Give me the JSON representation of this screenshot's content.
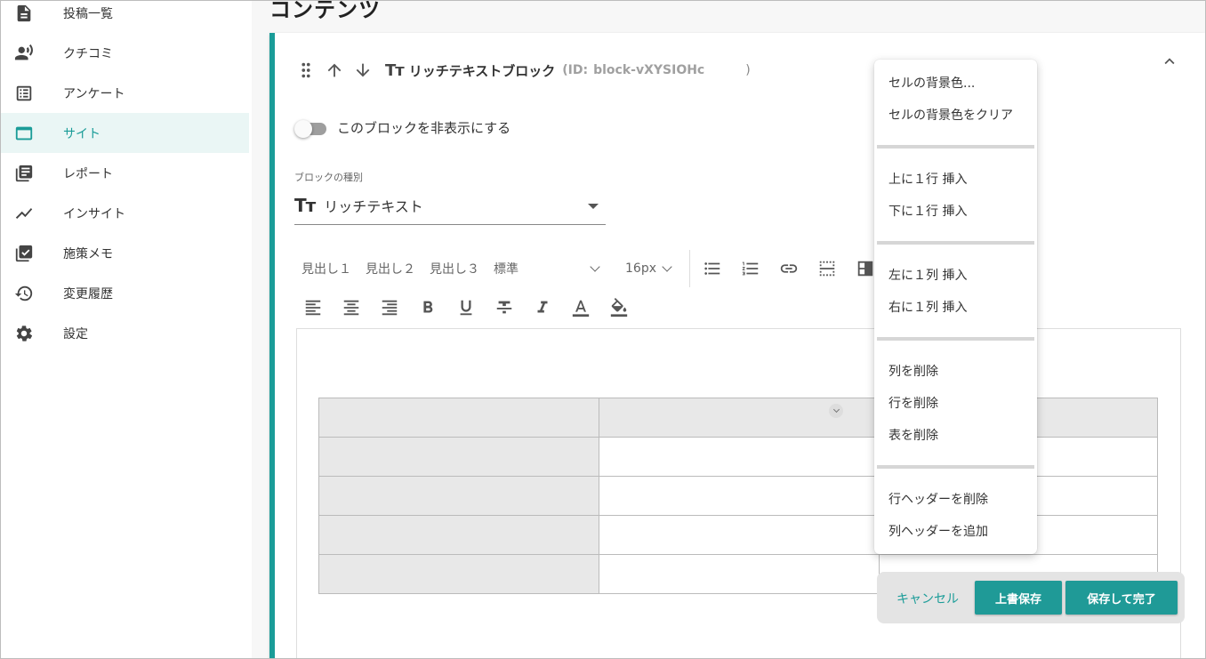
{
  "page": {
    "title": "コンテンツ"
  },
  "sidebar": {
    "items": [
      {
        "label": "投稿一覧",
        "icon": "document-icon"
      },
      {
        "label": "クチコミ",
        "icon": "person-voice-icon"
      },
      {
        "label": "アンケート",
        "icon": "list-icon"
      },
      {
        "label": "サイト",
        "icon": "browser-window-icon",
        "active": true
      },
      {
        "label": "レポート",
        "icon": "report-stack-icon"
      },
      {
        "label": "インサイト",
        "icon": "trend-icon"
      },
      {
        "label": "施策メモ",
        "icon": "checkbox-icon"
      },
      {
        "label": "変更履歴",
        "icon": "history-icon"
      },
      {
        "label": "設定",
        "icon": "gear-icon"
      }
    ]
  },
  "block": {
    "title": "リッチテキストブロック",
    "id_prefix": "(ID:",
    "id_value": "block-vXYSIOHc",
    "id_suffix": ")",
    "tt_glyph": "Tт",
    "hide_toggle_label": "このブロックを非表示にする",
    "hide_toggle_on": false,
    "type_label": "ブロックの種別",
    "type_value": "リッチテキスト"
  },
  "toolbar": {
    "heading1": "見出し１",
    "heading2": "見出し２",
    "heading3": "見出し３",
    "style_select": "標準",
    "size_select": "16px"
  },
  "table": {
    "rows": 5,
    "cols": 3
  },
  "context_menu": {
    "items": [
      "セルの背景色...",
      "セルの背景色をクリア",
      "上に１行 挿入",
      "下に１行 挿入",
      "左に１列 挿入",
      "右に１列 挿入",
      "列を削除",
      "行を削除",
      "表を削除",
      "行ヘッダーを削除",
      "列ヘッダーを追加"
    ]
  },
  "actions": {
    "cancel": "キャンセル",
    "overwrite_save": "上書保存",
    "save_and_finish": "保存して完了"
  },
  "colors": {
    "accent": "#1a9c98",
    "active_bg": "#eaf6f5"
  }
}
